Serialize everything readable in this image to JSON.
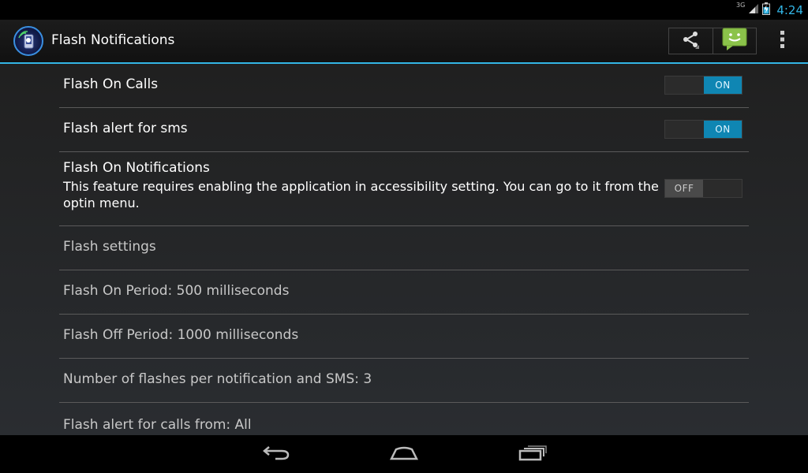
{
  "status_bar": {
    "network": "3G",
    "time": "4:24"
  },
  "action_bar": {
    "title": "Flash Notifications",
    "actions": [
      {
        "icon": "share-icon"
      },
      {
        "icon": "android-message-icon"
      }
    ],
    "overflow_icon": "overflow-menu-icon"
  },
  "settings": {
    "flash_on_calls": {
      "title": "Flash On Calls",
      "state": "ON"
    },
    "flash_alert_sms": {
      "title": "Flash alert for sms",
      "state": "ON"
    },
    "flash_on_notifications": {
      "title": "Flash On Notifications",
      "summary": "This feature requires enabling the application in accessibility setting. You can go to it from the optin menu.",
      "state": "OFF"
    },
    "flash_settings": {
      "title": "Flash settings"
    },
    "flash_on_period": {
      "title": "Flash On Period: 500 milliseconds"
    },
    "flash_off_period": {
      "title": "Flash Off Period: 1000 milliseconds"
    },
    "flash_count": {
      "title": "Number of flashes per notification and SMS: 3"
    },
    "flash_calls_from": {
      "title": "Flash alert for calls from: All"
    }
  },
  "nav_bar": {
    "buttons": [
      "back-icon",
      "home-icon",
      "recent-apps-icon"
    ]
  },
  "colors": {
    "accent": "#33b5e5",
    "toggle_on": "#0f86b3",
    "toggle_off": "#4a4a4a"
  }
}
